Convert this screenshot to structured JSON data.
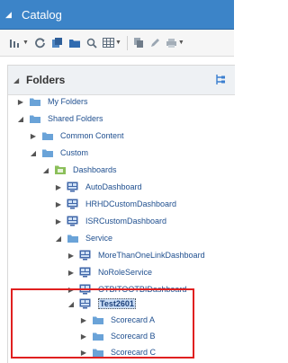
{
  "window": {
    "title": "Catalog"
  },
  "toolbar": {
    "icons": [
      "view-icon",
      "refresh-icon",
      "new-item-icon",
      "folder-icon",
      "search-icon",
      "grid-icon",
      "copy-icon",
      "edit-icon",
      "print-icon"
    ]
  },
  "folders_panel": {
    "title": "Folders"
  },
  "tree": {
    "my_folders": "My Folders",
    "shared_folders": "Shared Folders",
    "common_content": "Common Content",
    "custom": "Custom",
    "dashboards": "Dashboards",
    "auto_dashboard": "AutoDashboard",
    "hrhd_dashboard": "HRHDCustomDashboard",
    "isr_dashboard": "ISRCustomDashboard",
    "service": "Service",
    "more_than_one_link": "MoreThanOneLinkDashboard",
    "no_role_service": "NoRoleService",
    "otbitootbi": "OTBITOOTBIDashboard",
    "test2601": "Test2601",
    "scorecard_a": "Scorecard A",
    "scorecard_b": "Scorecard B",
    "scorecard_c": "Scorecard C"
  },
  "colors": {
    "titlebar": "#3c84c8",
    "folder": "#6aa3d8",
    "dashboard_icon": "#3f66a8",
    "highlight_box": "#e02020",
    "selection": "#c9ddf6"
  }
}
